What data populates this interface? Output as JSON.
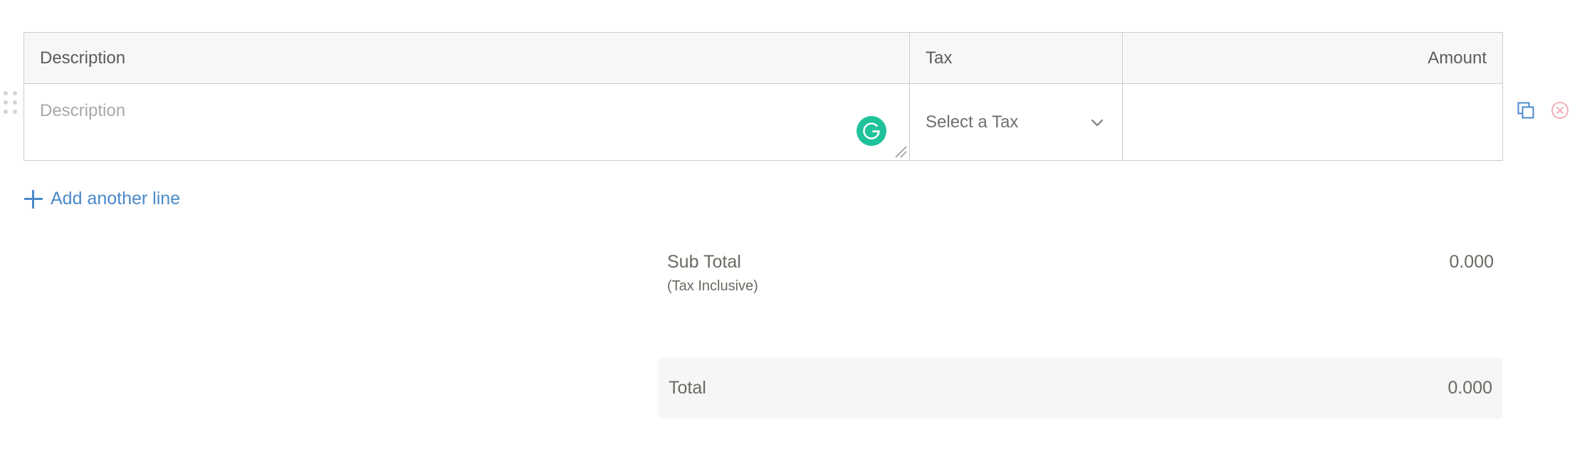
{
  "colors": {
    "table_border": "#cccccc",
    "header_bg": "#f7f7f7",
    "total_band_bg": "#f6f6f6",
    "link_blue": "#4b89c9",
    "grammarly_green": "#20c29b",
    "delete_pink": "#f0a9ae",
    "copy_blue": "#4b89c9",
    "text_gray": "#6f6f6f",
    "placeholder_gray": "#a8a8a8",
    "handle_dot": "#d2d4d6"
  },
  "line_items_table": {
    "columns": [
      {
        "label": "Description",
        "align": "left"
      },
      {
        "label": "Tax",
        "align": "left"
      },
      {
        "label": "Amount",
        "align": "right"
      }
    ],
    "rows": [
      {
        "description_value": "",
        "description_placeholder": "Description",
        "tax_selected": "Select a Tax",
        "amount_value": ""
      }
    ]
  },
  "row_actions": {
    "copy_icon": "copy-icon",
    "copy_title": "Copy",
    "delete_icon": "remove-circle-icon",
    "delete_title": "Remove"
  },
  "drag_handle": {
    "icon": "drag-handle-icon",
    "dot_count": 6
  },
  "grammarly": {
    "icon": "grammarly-icon",
    "letter": "G"
  },
  "resize_grip": {
    "icon": "resize-grip-icon"
  },
  "add_line": {
    "icon": "plus-icon",
    "label": "Add another line"
  },
  "totals": {
    "sub_total": {
      "label": "Sub Total",
      "note": "(Tax Inclusive)",
      "value": "0.000"
    },
    "total": {
      "label": "Total",
      "value": "0.000"
    }
  }
}
